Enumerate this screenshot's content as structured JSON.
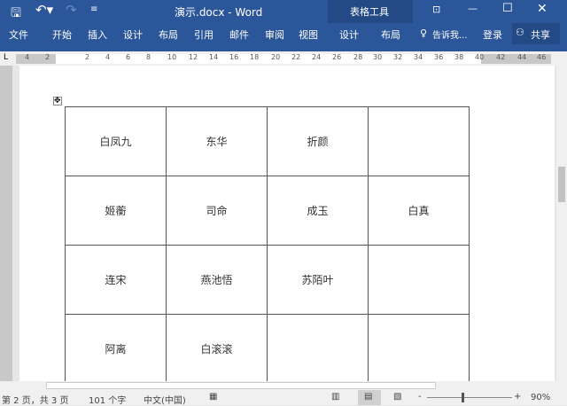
{
  "title": "演示.docx - Word",
  "context_tab_group": "表格工具",
  "tabs": [
    "文件",
    "开始",
    "插入",
    "设计",
    "布局",
    "引用",
    "邮件",
    "审阅",
    "视图",
    "设计",
    "布局"
  ],
  "tell_me": "告诉我...",
  "login": "登录",
  "share": "共享",
  "ruler_numbers": [
    "4",
    "2",
    "2",
    "4",
    "6",
    "8",
    "10",
    "12",
    "14",
    "16",
    "18",
    "20",
    "22",
    "24",
    "26",
    "28",
    "30",
    "32",
    "34",
    "36",
    "38",
    "40",
    "42",
    "44",
    "46"
  ],
  "table": [
    [
      "白凤九",
      "东华",
      "折颜",
      ""
    ],
    [
      "姬蘅",
      "司命",
      "成玉",
      "白真"
    ],
    [
      "连宋",
      "燕池悟",
      "苏陌叶",
      ""
    ],
    [
      "阿离",
      "白滚滚",
      "",
      ""
    ]
  ],
  "status": {
    "page": "第 2 页，共 3 页",
    "words": "101 个字",
    "language": "中文(中国)",
    "zoom": "90%"
  },
  "colors": {
    "ribbon": "#2b579a",
    "context": "#234a84"
  }
}
